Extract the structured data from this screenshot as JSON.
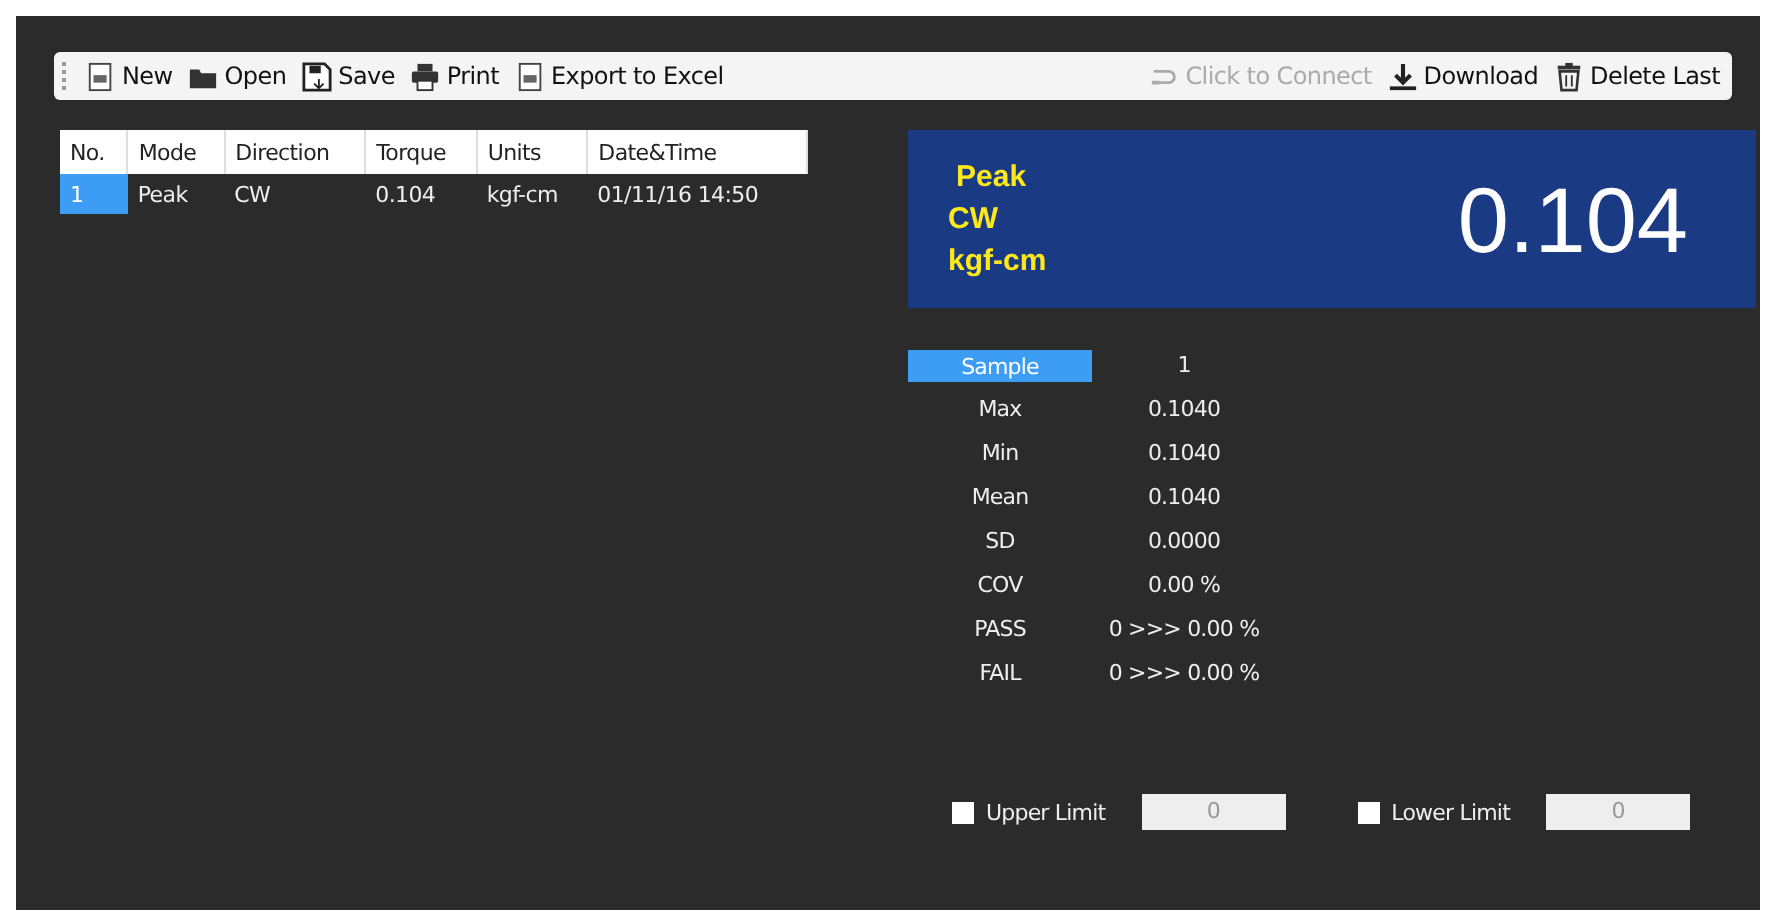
{
  "toolbar": {
    "left": [
      {
        "label": "New",
        "disabled": false
      },
      {
        "label": "Open",
        "disabled": false
      },
      {
        "label": "Save",
        "disabled": false
      },
      {
        "label": "Print",
        "disabled": false
      },
      {
        "label": "Export to Excel",
        "disabled": false
      }
    ],
    "right": [
      {
        "label": "Click to Connect",
        "disabled": true
      },
      {
        "label": "Download",
        "disabled": false
      },
      {
        "label": "Delete Last",
        "disabled": false
      }
    ]
  },
  "table": {
    "columns": [
      "No.",
      "Mode",
      "Direction",
      "Torque",
      "Units",
      "Date&Time"
    ],
    "rows": [
      {
        "cells": [
          "1",
          "Peak",
          "CW",
          "0.104",
          "kgf-cm",
          "01/11/16 14:50"
        ],
        "selected": true
      }
    ]
  },
  "display": {
    "mode": "Peak",
    "direction": "CW",
    "units": "kgf-cm",
    "value": "0.104"
  },
  "stats": [
    {
      "label": "Sample",
      "value": "1",
      "kind": "button"
    },
    {
      "label": "Max",
      "value": "0.1040",
      "kind": "text"
    },
    {
      "label": "Min",
      "value": "0.1040",
      "kind": "text"
    },
    {
      "label": "Mean",
      "value": "0.1040",
      "kind": "text"
    },
    {
      "label": "SD",
      "value": "0.0000",
      "kind": "text"
    },
    {
      "label": "COV",
      "value": "0.00 %",
      "kind": "text"
    },
    {
      "label": "PASS",
      "value": "0 >>> 0.00 %",
      "kind": "text"
    },
    {
      "label": "FAIL",
      "value": "0 >>> 0.00 %",
      "kind": "text"
    }
  ],
  "limits": [
    {
      "label": "Upper Limit",
      "checked": false,
      "value": "0"
    },
    {
      "label": "Lower Limit",
      "checked": false,
      "value": "0"
    }
  ]
}
